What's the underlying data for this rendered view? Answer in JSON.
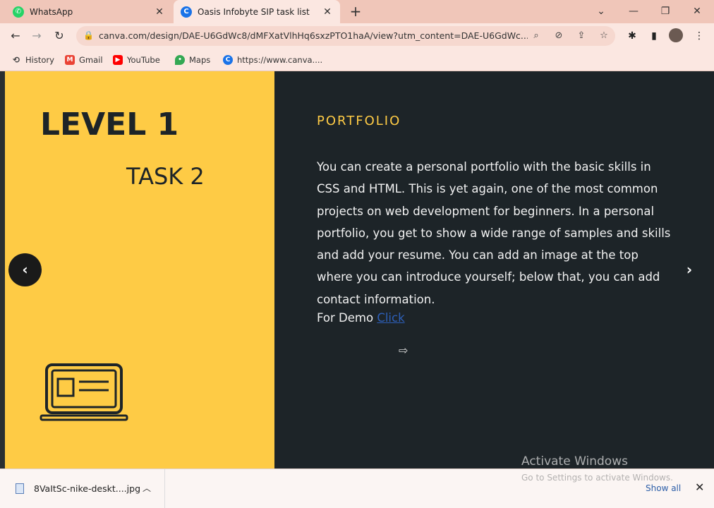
{
  "tabs": [
    {
      "title": "WhatsApp",
      "favicon": "whatsapp-icon",
      "color": "#25d366"
    },
    {
      "title": "Oasis Infobyte SIP task list",
      "favicon": "canva-icon",
      "color": "#1a73e8"
    }
  ],
  "toolbar": {
    "url": "canva.com/design/DAE-U6GdWc8/dMFXatVlhHq6sxzPTO1haA/view?utm_content=DAE-U6GdWc..."
  },
  "bookmarks": [
    {
      "label": "History",
      "icon": "history-icon"
    },
    {
      "label": "Gmail",
      "icon": "gmail-icon"
    },
    {
      "label": "YouTube",
      "icon": "youtube-icon"
    },
    {
      "label": "Maps",
      "icon": "maps-icon"
    },
    {
      "label": "https://www.canva....",
      "icon": "canva-icon"
    }
  ],
  "slide": {
    "level": "LEVEL 1",
    "task": "TASK 2",
    "heading": "PORTFOLIO",
    "body": "You can create a personal portfolio with the basic skills in CSS and HTML. This is yet again, one of the most common projects on web development for beginners. In a personal portfolio, you get to show a wide range of samples and skills and add your resume. You can add an image at the top where you can introduce yourself; below that, you can add contact information.",
    "demo_label": "For Demo",
    "demo_link": "Click"
  },
  "watermark": {
    "line1": "Activate Windows",
    "line2": "Go to Settings to activate Windows."
  },
  "download": {
    "filename": "8VaItSc-nike-deskt....jpg",
    "show_all": "Show all"
  },
  "colors": {
    "accent": "#fecb45",
    "panel": "#1d2428",
    "link": "#2d5fb8"
  }
}
